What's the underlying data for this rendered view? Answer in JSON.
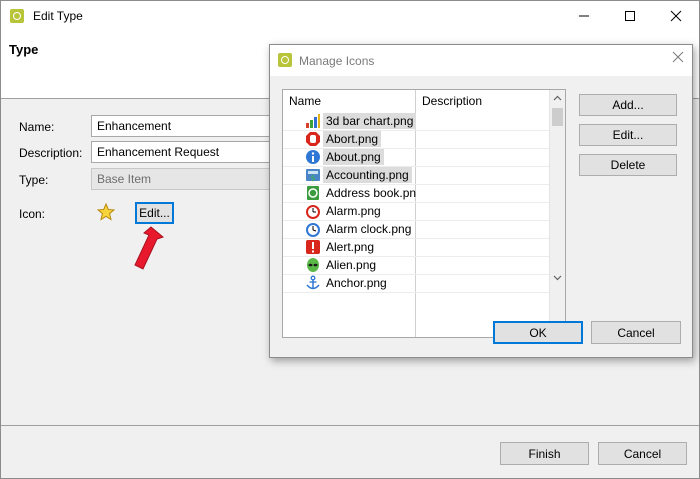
{
  "window": {
    "title": "Edit Type",
    "header": "Type",
    "controls": {
      "minimize": "—",
      "maximize": "☐",
      "close": "✕"
    }
  },
  "form": {
    "name_label": "Name:",
    "name_value": "Enhancement",
    "description_label": "Description:",
    "description_value": "Enhancement Request",
    "type_label": "Type:",
    "type_value": "Base Item",
    "icon_label": "Icon:",
    "icon_edit_label": "Edit..."
  },
  "footer": {
    "finish_label": "Finish",
    "cancel_label": "Cancel"
  },
  "dialog": {
    "title": "Manage Icons",
    "columns": {
      "name": "Name",
      "description": "Description"
    },
    "rows": [
      {
        "name": "3d bar chart.png",
        "icon": "bar-chart-icon"
      },
      {
        "name": "Abort.png",
        "icon": "abort-icon"
      },
      {
        "name": "About.png",
        "icon": "info-icon"
      },
      {
        "name": "Accounting.png",
        "icon": "accounting-icon"
      },
      {
        "name": "Address book.pn",
        "icon": "address-book-icon"
      },
      {
        "name": "Alarm.png",
        "icon": "alarm-icon"
      },
      {
        "name": "Alarm clock.png",
        "icon": "alarm-clock-icon"
      },
      {
        "name": "Alert.png",
        "icon": "alert-icon"
      },
      {
        "name": "Alien.png",
        "icon": "alien-icon"
      },
      {
        "name": "Anchor.png",
        "icon": "anchor-icon"
      }
    ],
    "add_label": "Add...",
    "edit_label": "Edit...",
    "delete_label": "Delete",
    "ok_label": "OK",
    "cancel_label": "Cancel"
  },
  "colors": {
    "accent": "#0078d7",
    "app_icon": "#b8c43a",
    "arrow": "#e8192c"
  }
}
